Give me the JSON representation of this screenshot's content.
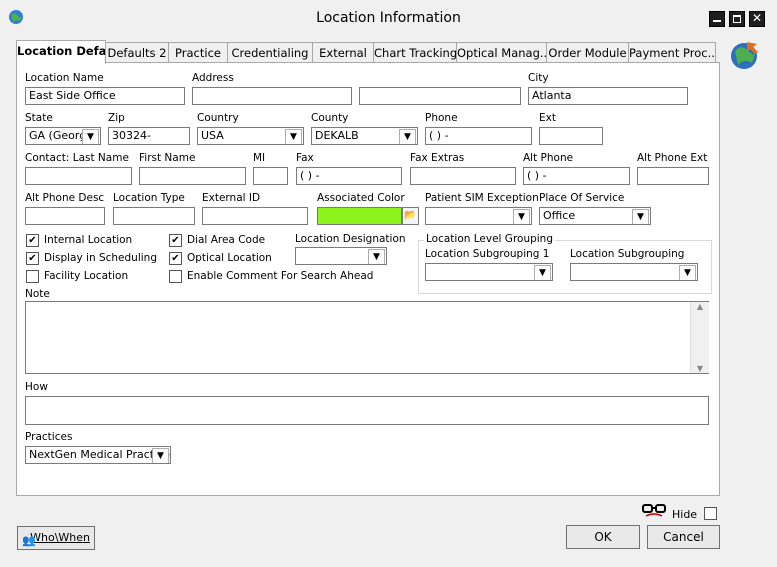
{
  "window": {
    "title": "Location Information"
  },
  "tabs": [
    {
      "label": "Location Defa..."
    },
    {
      "label": "Defaults 2"
    },
    {
      "label": "Practice"
    },
    {
      "label": "Credentialing"
    },
    {
      "label": "External"
    },
    {
      "label": "Chart Tracking"
    },
    {
      "label": "Optical Manag..."
    },
    {
      "label": "Order Module"
    },
    {
      "label": "Payment Proc..."
    }
  ],
  "labels": {
    "location_name": "Location Name",
    "address": "Address",
    "city": "City",
    "state": "State",
    "zip": "Zip",
    "country": "Country",
    "county": "County",
    "phone": "Phone",
    "ext": "Ext",
    "contact_last": "Contact: Last Name",
    "first_name": "First Name",
    "mi": "MI",
    "fax": "Fax",
    "fax_extras": "Fax Extras",
    "alt_phone": "Alt Phone",
    "alt_phone_ext": "Alt Phone Ext",
    "alt_phone_desc": "Alt Phone Desc",
    "location_type": "Location Type",
    "external_id": "External ID",
    "associated_color": "Associated Color",
    "patient_sim": "Patient SIM Exception",
    "place_of_service": "Place Of Service",
    "location_designation": "Location Designation",
    "level_grouping": "Location Level Grouping",
    "subgrouping1": "Location Subgrouping 1",
    "subgrouping": "Location Subgrouping",
    "note": "Note",
    "how": "How",
    "practices": "Practices"
  },
  "values": {
    "location_name": "East Side Office",
    "city": "Atlanta",
    "state": "GA  (Georg",
    "zip": "30324-",
    "country": "USA",
    "county": "DEKALB",
    "phone": "(  )    -",
    "fax": "(  )    -",
    "alt_phone": "(  )    -",
    "place_of_service": "Office",
    "practices": "NextGen Medical Practice",
    "associated_color": "#8cf41c"
  },
  "checkboxes": {
    "internal_location": {
      "label": "Internal Location",
      "checked": "✔"
    },
    "display_scheduling": {
      "label": "Display in Scheduling",
      "checked": "✔"
    },
    "facility_location": {
      "label": "Facility Location",
      "checked": ""
    },
    "dial_area_code": {
      "label": "Dial Area Code",
      "checked": "✔"
    },
    "optical_location": {
      "label": "Optical Location",
      "checked": "✔"
    },
    "enable_comment": {
      "label": "Enable Comment For Search Ahead",
      "checked": ""
    }
  },
  "footer": {
    "hide_label": "Hide",
    "whowhen_label": "Who\\When",
    "ok_label": "OK",
    "cancel_label": "Cancel"
  }
}
